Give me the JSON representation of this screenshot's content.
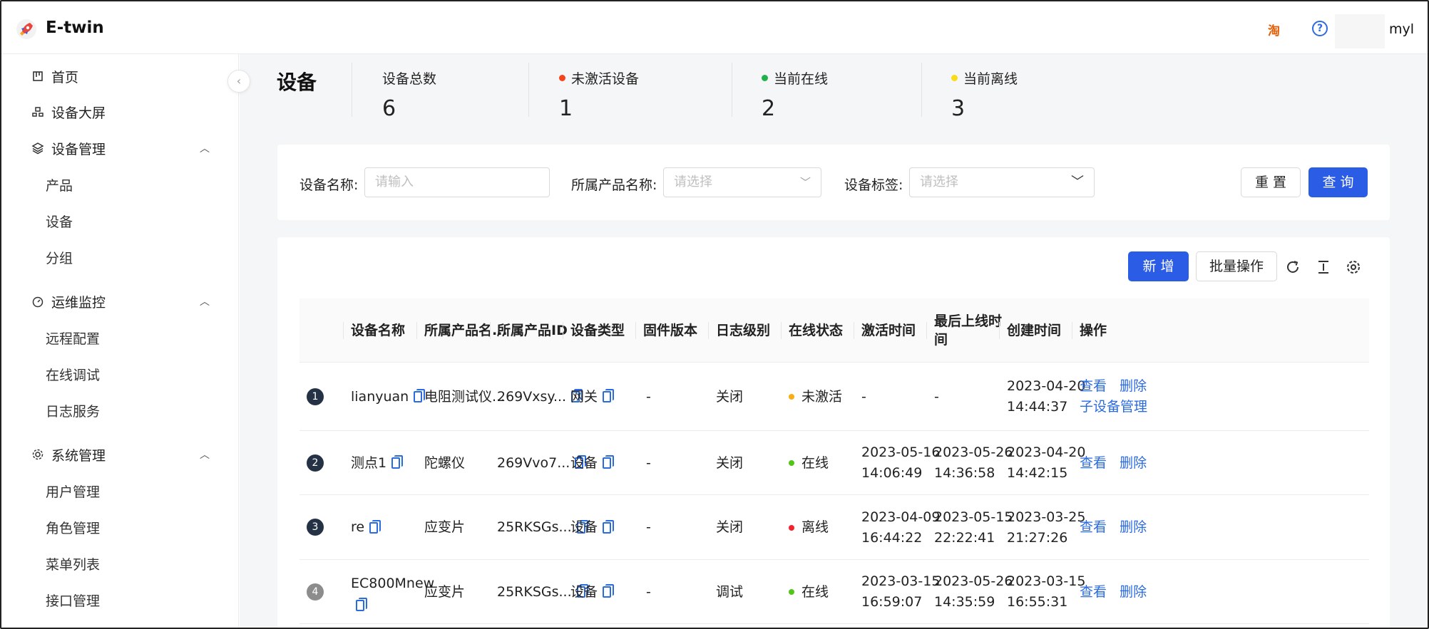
{
  "header": {
    "brand": "E-twin",
    "taobao_icon": "淘",
    "help_icon": "?",
    "username": "myl"
  },
  "sidebar": {
    "items": [
      {
        "label": "首页",
        "icon": "home-icon"
      },
      {
        "label": "设备大屏",
        "icon": "dashboard-icon"
      },
      {
        "label": "设备管理",
        "icon": "layers-icon",
        "children": [
          "产品",
          "设备",
          "分组"
        ]
      },
      {
        "label": "运维监控",
        "icon": "gauge-icon",
        "children": [
          "远程配置",
          "在线调试",
          "日志服务"
        ]
      },
      {
        "label": "系统管理",
        "icon": "gear-icon",
        "children": [
          "用户管理",
          "角色管理",
          "菜单列表",
          "接口管理"
        ]
      }
    ]
  },
  "stats": {
    "title": "设备",
    "total_label": "设备总数",
    "total_value": "6",
    "inactive_label": "未激活设备",
    "inactive_value": "1",
    "online_label": "当前在线",
    "online_value": "2",
    "offline_label": "当前离线",
    "offline_value": "3",
    "colors": {
      "inactive": "#f5431b",
      "online": "#1fb24a",
      "offline": "#fadb14"
    }
  },
  "filter": {
    "name_label": "设备名称:",
    "name_placeholder": "请输入",
    "product_label": "所属产品名称:",
    "product_placeholder": "请选择",
    "tag_label": "设备标签:",
    "tag_placeholder": "请选择",
    "reset": "重 置",
    "query": "查 询"
  },
  "toolbar": {
    "add": "新 增",
    "batch": "批量操作"
  },
  "table": {
    "columns": [
      "设备名称",
      "所属产品名...",
      "所属产品ID",
      "设备类型",
      "固件版本",
      "日志级别",
      "在线状态",
      "激活时间",
      "最后上线时间",
      "创建时间",
      "操作"
    ],
    "view": "查看",
    "delete": "删除",
    "sub_manage": "子设备管理",
    "rows": [
      {
        "index": "1",
        "name": "lianyuan",
        "product": "电阻测试仪...",
        "product_id": "269Vxsy...",
        "type": "网关",
        "firmware": "-",
        "log_level": "关闭",
        "status": "未激活",
        "status_color": "#faad14",
        "activated_date": "-",
        "activated_time": "",
        "last_online_date": "-",
        "last_online_time": "",
        "created_date": "2023-04-20",
        "created_time": "14:44:37"
      },
      {
        "index": "2",
        "name": "测点1",
        "product": "陀螺仪",
        "product_id": "269Vvo7...",
        "type": "设备",
        "firmware": "-",
        "log_level": "关闭",
        "status": "在线",
        "status_color": "#52c41a",
        "activated_date": "2023-05-16",
        "activated_time": "14:06:49",
        "last_online_date": "2023-05-26",
        "last_online_time": "14:36:58",
        "created_date": "2023-04-20",
        "created_time": "14:42:15"
      },
      {
        "index": "3",
        "name": "re",
        "product": "应变片",
        "product_id": "25RKSGs...",
        "type": "设备",
        "firmware": "-",
        "log_level": "关闭",
        "status": "离线",
        "status_color": "#f5222d",
        "activated_date": "2023-04-09",
        "activated_time": "16:44:22",
        "last_online_date": "2023-05-15",
        "last_online_time": "22:22:41",
        "created_date": "2023-03-25",
        "created_time": "21:27:26"
      },
      {
        "index": "4",
        "name": "EC800Mnew",
        "product": "应变片",
        "product_id": "25RKSGs...",
        "type": "设备",
        "firmware": "-",
        "log_level": "调试",
        "status": "在线",
        "status_color": "#52c41a",
        "activated_date": "2023-03-15",
        "activated_time": "16:59:07",
        "last_online_date": "2023-05-26",
        "last_online_time": "14:35:59",
        "created_date": "2023-03-15",
        "created_time": "16:55:31"
      }
    ]
  }
}
